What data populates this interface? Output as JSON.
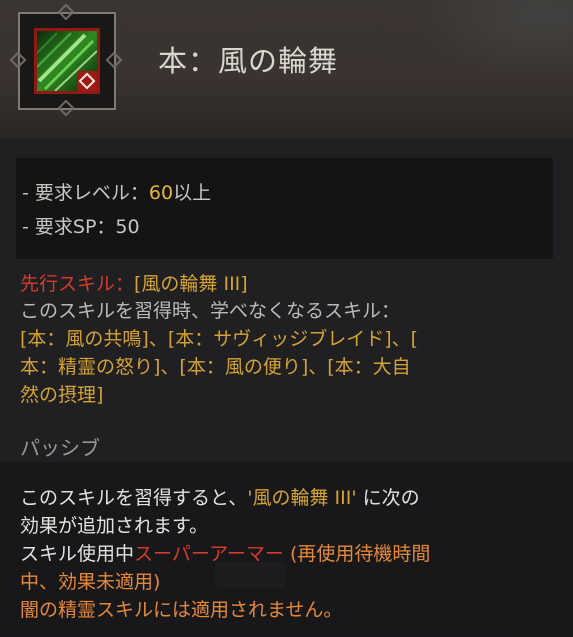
{
  "skill": {
    "title": "本：風の輪舞",
    "icon": "wind-blade-skill-icon"
  },
  "requirements": {
    "level_label": "- 要求レベル：",
    "level_value": "60",
    "level_suffix": "以上",
    "sp_label": "- 要求SP：50"
  },
  "prerequisite": {
    "label": "先行スキル：",
    "value": "[風の輪舞 III]"
  },
  "unlearn": {
    "lines": [
      "このスキルを習得時、学べなくなるスキル：",
      "[本：風の共鳴]、[本：サヴィッジブレイド]、[",
      "本：精霊の怒り]、[本：風の便り]、[本：大自",
      "然の摂理]"
    ]
  },
  "type_label": "パッシブ",
  "description": {
    "line1_pre": "このスキルを習得すると、",
    "line1_quote": "'風の輪舞 III'",
    "line1_post": " に次の",
    "line2": "効果が追加されます。",
    "line3_pre": "スキル使用中",
    "line3_red": "スーパーアーマー",
    "line3_post": " (再使用待機時間",
    "line4": "中、効果未適用)",
    "line5": "闇の精霊スキルには適用されません。"
  },
  "colors": {
    "gold": "#e7b53a",
    "red": "#d73a2b",
    "orange": "#e6883a"
  }
}
